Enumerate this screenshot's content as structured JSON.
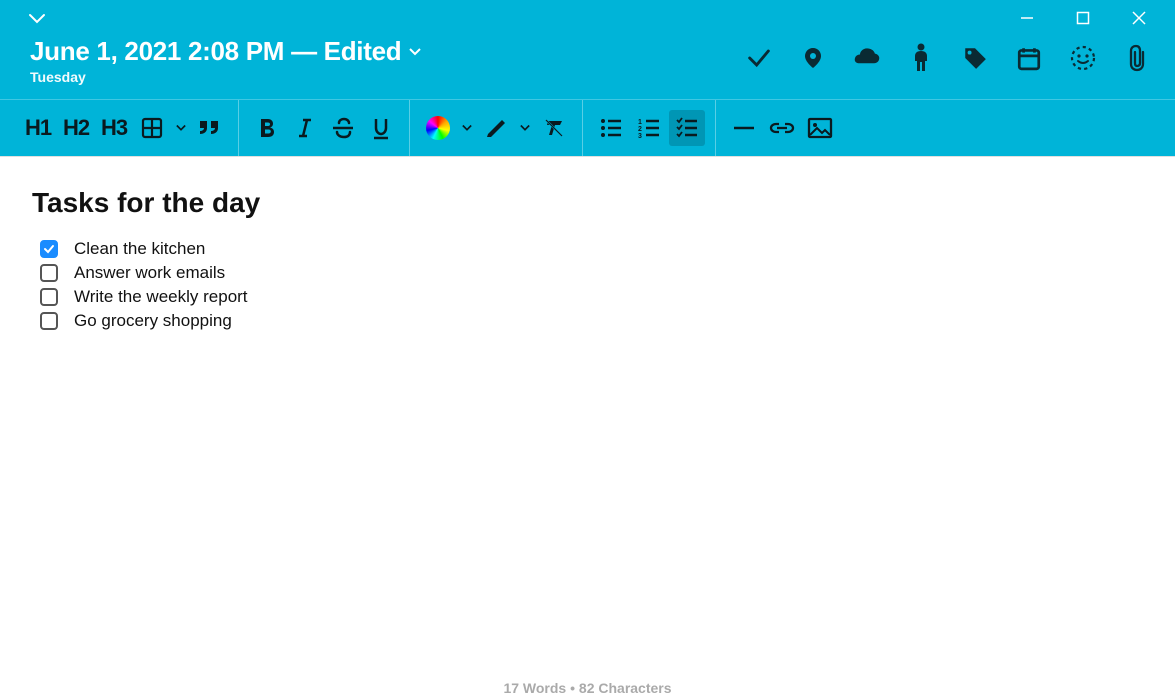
{
  "header": {
    "title": "June 1, 2021 2:08 PM — Edited",
    "subtitle": "Tuesday"
  },
  "icons": {
    "done": "done-icon",
    "location": "location-icon",
    "cloud": "cloud-icon",
    "person": "person-icon",
    "tag": "tag-icon",
    "calendar": "calendar-icon",
    "emoji": "emoji-icon",
    "attach": "attachment-icon"
  },
  "toolbar": {
    "h1": "H1",
    "h2": "H2",
    "h3": "H3"
  },
  "document": {
    "title": "Tasks for the day",
    "tasks": [
      {
        "text": "Clean the kitchen",
        "checked": true
      },
      {
        "text": "Answer work emails",
        "checked": false
      },
      {
        "text": "Write the weekly report",
        "checked": false
      },
      {
        "text": "Go grocery shopping",
        "checked": false
      }
    ]
  },
  "status": {
    "words": "17 Words",
    "sep": " • ",
    "chars": "82 Characters"
  }
}
